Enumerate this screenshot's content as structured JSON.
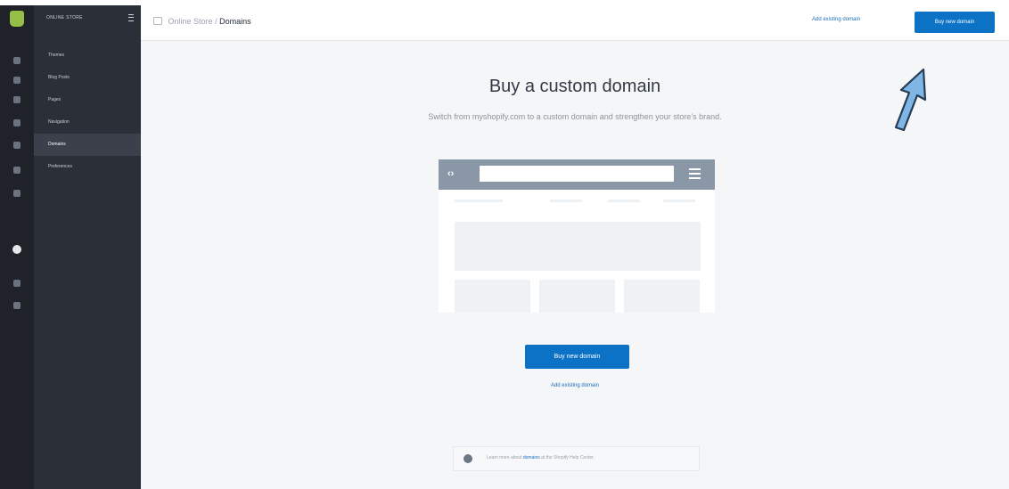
{
  "rail": {
    "icons": [
      "home-icon",
      "orders-icon",
      "products-icon",
      "customers-icon",
      "reports-icon",
      "discounts-icon",
      "apps-icon",
      "online-store-icon",
      "pos-icon",
      "settings-icon"
    ]
  },
  "sidebar": {
    "store_label": "ONLINE STORE",
    "items": [
      {
        "label": "Themes"
      },
      {
        "label": "Blog Posts"
      },
      {
        "label": "Pages"
      },
      {
        "label": "Navigation"
      },
      {
        "label": "Domains"
      },
      {
        "label": "Preferences"
      }
    ]
  },
  "header": {
    "parent": "Online Store",
    "separator": "/",
    "current": "Domains",
    "add_existing_label": "Add existing domain",
    "buy_label": "Buy new domain"
  },
  "main": {
    "title": "Buy a custom domain",
    "subtitle": "Switch from myshopify.com to a custom domain and strengthen your store’s brand.",
    "buy_label": "Buy new domain",
    "add_existing_label": "Add existing domain",
    "help_prefix": "Learn more about",
    "help_link": "domains",
    "help_suffix": "at the Shopify Help Center."
  },
  "colors": {
    "accent": "#0b72c6",
    "sidebar_dark": "#1f2229",
    "sidebar_sub": "#2b2f38",
    "annotation_arrow": "#7fb6e6"
  }
}
